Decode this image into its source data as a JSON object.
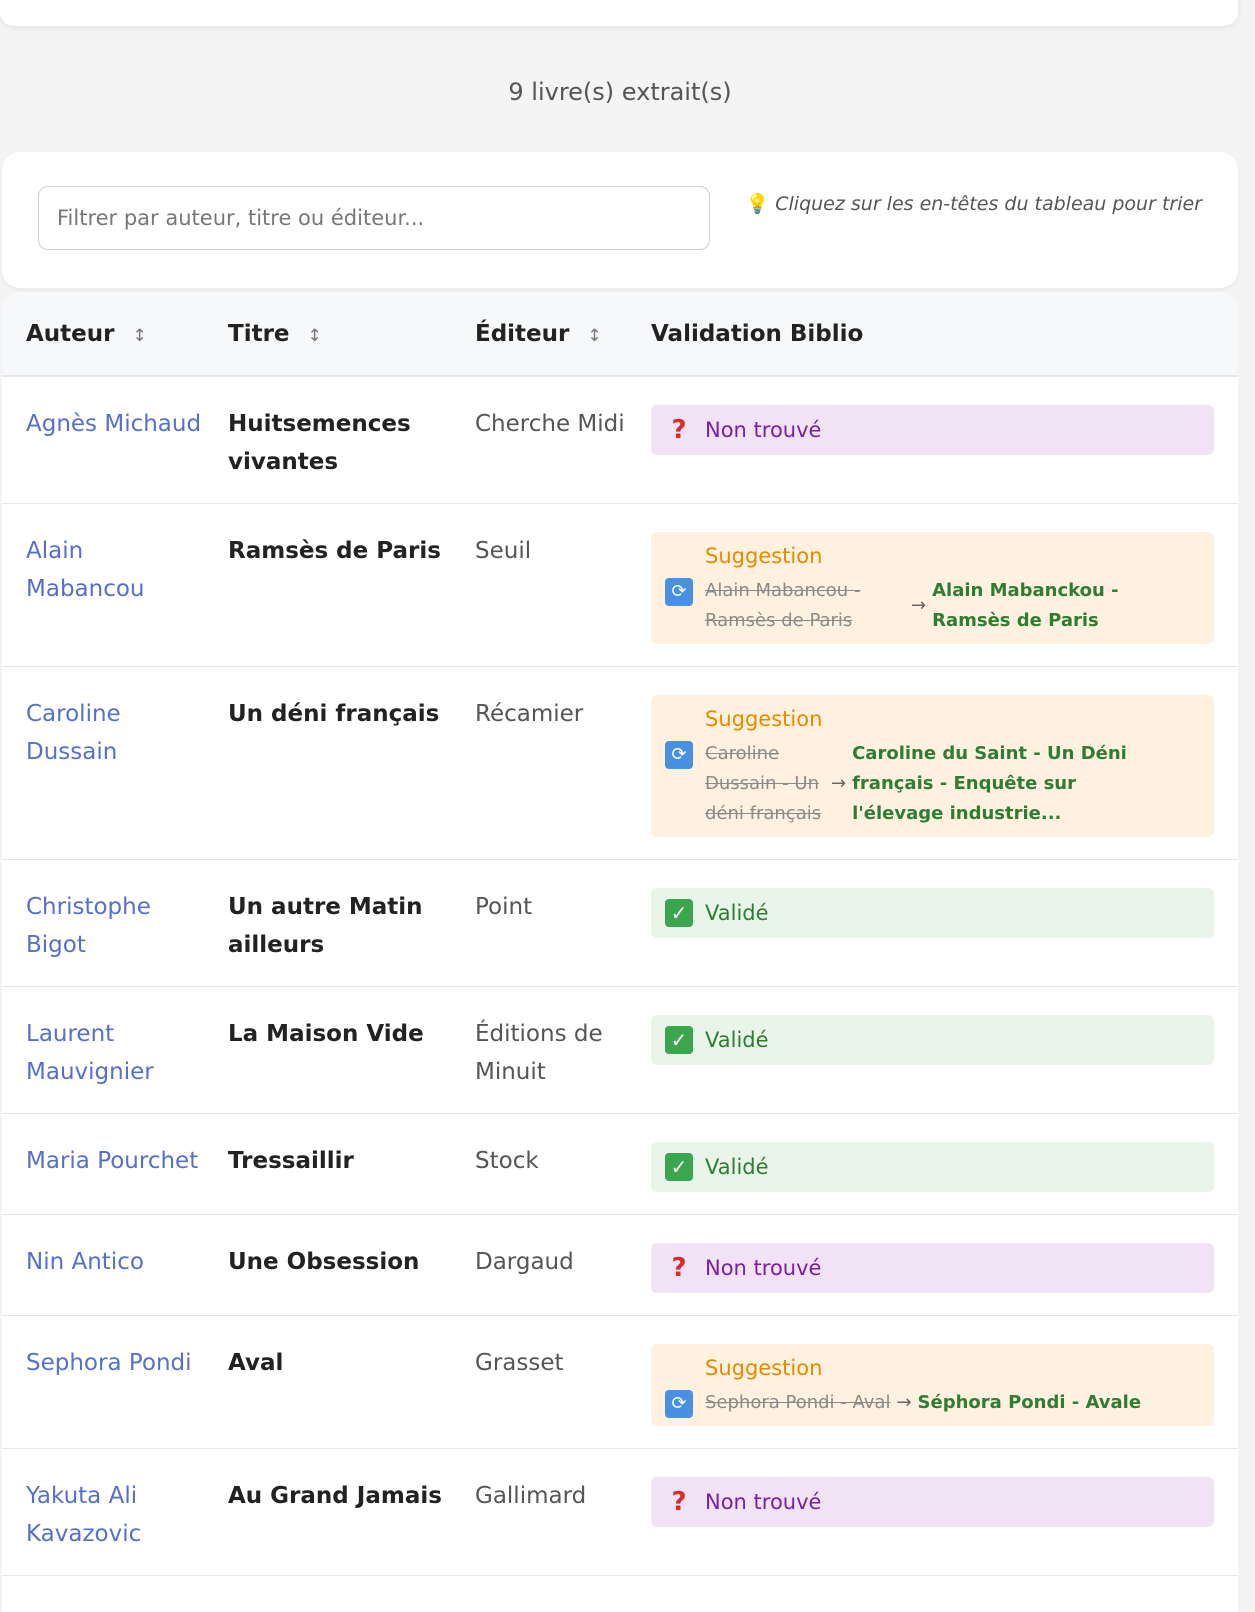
{
  "summary": {
    "count_text": "9 livre(s) extrait(s)"
  },
  "filter": {
    "placeholder": "Filtrer par auteur, titre ou éditeur...",
    "hint": "Cliquez sur les en-têtes du tableau pour trier"
  },
  "table": {
    "headers": {
      "author": "Auteur",
      "title": "Titre",
      "editor": "Éditeur",
      "validation": "Validation Biblio"
    },
    "sort_glyph": "↕",
    "rows": [
      {
        "author": "Agnès Michaud",
        "title": "Huitsemences vivantes",
        "editor": "Cherche Midi",
        "status": "notfound",
        "status_label": "Non trouvé"
      },
      {
        "author": "Alain Mabancou",
        "title": "Ramsès de Paris",
        "editor": "Seuil",
        "status": "suggestion",
        "status_label": "Suggestion",
        "old": "Alain Mabancou - Ramsès de Paris",
        "new": "Alain Mabanckou - Ramsès de Paris"
      },
      {
        "author": "Caroline Dussain",
        "title": "Un déni français",
        "editor": "Récamier",
        "status": "suggestion",
        "status_label": "Suggestion",
        "old": "Caroline Dussain - Un déni français",
        "new": "Caroline du Saint - Un Déni français - Enquête sur l'élevage industrie..."
      },
      {
        "author": "Christophe Bigot",
        "title": "Un autre Matin ailleurs",
        "editor": "Point",
        "status": "valid",
        "status_label": "Validé"
      },
      {
        "author": "Laurent Mauvignier",
        "title": "La Maison Vide",
        "editor": "Éditions de Minuit",
        "status": "valid",
        "status_label": "Validé"
      },
      {
        "author": "Maria Pourchet",
        "title": "Tressaillir",
        "editor": "Stock",
        "status": "valid",
        "status_label": "Validé"
      },
      {
        "author": "Nin Antico",
        "title": "Une Obsession",
        "editor": "Dargaud",
        "status": "notfound",
        "status_label": "Non trouvé"
      },
      {
        "author": "Sephora Pondi",
        "title": "Aval",
        "editor": "Grasset",
        "status": "suggestion",
        "status_label": "Suggestion",
        "old": "Sephora Pondi - Aval",
        "new": "Séphora Pondi - Avale"
      },
      {
        "author": "Yakuta Ali Kavazovic",
        "title": "Au Grand Jamais",
        "editor": "Gallimard",
        "status": "notfound",
        "status_label": "Non trouvé"
      }
    ]
  },
  "icons": {
    "notfound": "question-mark-icon",
    "valid": "check-box-icon",
    "suggestion": "refresh-icon",
    "hint": "light-bulb-icon"
  },
  "colors": {
    "link": "#5670c9",
    "valid": "#2e7d32",
    "suggestion": "#e68a00",
    "notfound": "#7a1fa2"
  }
}
